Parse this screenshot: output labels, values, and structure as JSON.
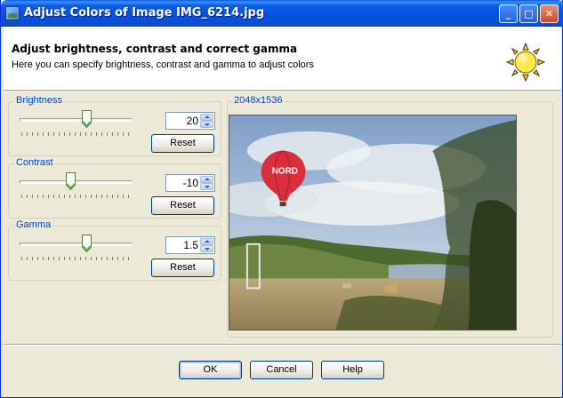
{
  "window": {
    "title": "Adjust Colors of Image IMG_6214.jpg"
  },
  "titlebar": {
    "minimize": "_",
    "maximize": "□",
    "close": "✕"
  },
  "header": {
    "title": "Adjust brightness, contrast and correct gamma",
    "subtitle": "Here you can specify brightness, contrast and gamma to adjust colors",
    "icon": "sun-icon"
  },
  "controls": [
    {
      "label": "Brightness",
      "value": "20",
      "slider_fraction": 0.6,
      "reset_label": "Reset"
    },
    {
      "label": "Contrast",
      "value": "-10",
      "slider_fraction": 0.45,
      "reset_label": "Reset"
    },
    {
      "label": "Gamma",
      "value": "1.5",
      "slider_fraction": 0.6,
      "reset_label": "Reset"
    }
  ],
  "preview": {
    "label": "2048x1536",
    "balloon_text": "NORD"
  },
  "footer": {
    "ok": "OK",
    "cancel": "Cancel",
    "help": "Help"
  },
  "colors": {
    "titlebar": "#0a5ce6",
    "group_label": "#0046d5",
    "dialog_bg": "#ece9d8"
  }
}
